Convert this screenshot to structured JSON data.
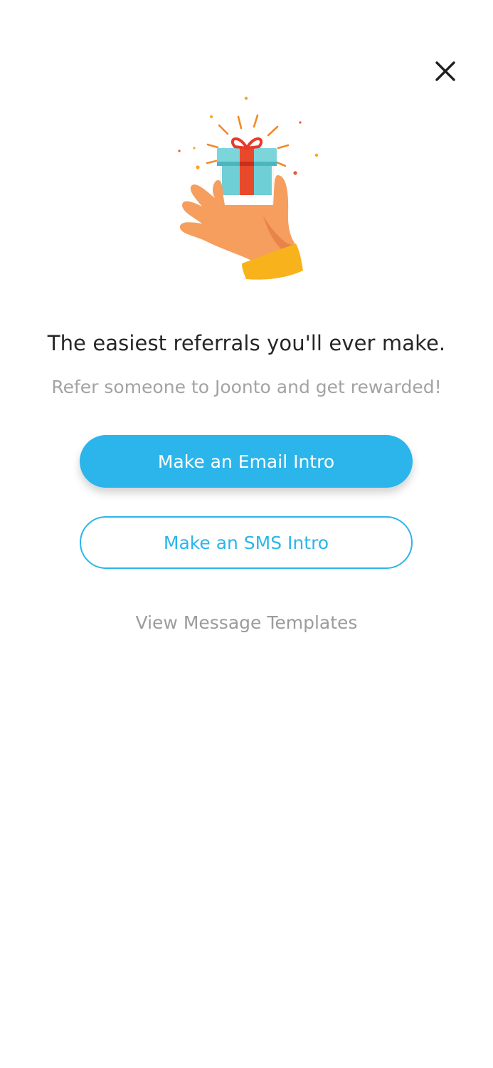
{
  "header": {
    "close_icon": "close-icon"
  },
  "illustration": {
    "icon": "hand-holding-gift-icon"
  },
  "content": {
    "headline": "The easiest referrals you'll ever make.",
    "subline": "Refer someone to Joonto and get rewarded!"
  },
  "actions": {
    "email_intro_label": "Make an Email Intro",
    "sms_intro_label": "Make an SMS Intro",
    "templates_link_label": "View Message Templates"
  },
  "colors": {
    "accent": "#2bb5ea",
    "headline": "#262626",
    "muted": "#a3a3a3"
  }
}
